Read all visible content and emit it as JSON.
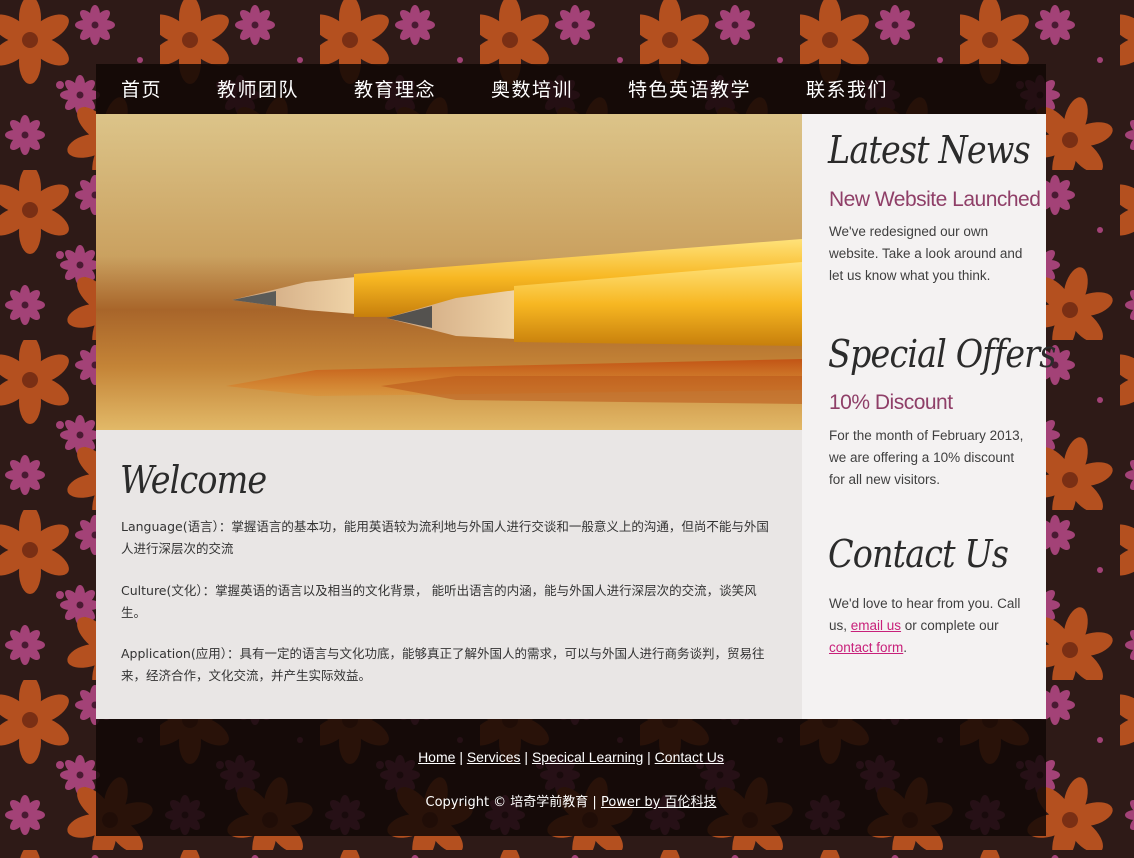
{
  "nav": {
    "items": [
      "首页",
      "教师团队",
      "教育理念",
      "奥数培训",
      "特色英语教学",
      "联系我们"
    ]
  },
  "main": {
    "welcome_title": "Welcome",
    "paragraphs": [
      "Language(语言）：掌握语言的基本功，能用英语较为流利地与外国人进行交谈和一般意义上的沟通，但尚不能与外国人进行深层次的交流",
      "Culture(文化）：掌握英语的语言以及相当的文化背景， 能听出语言的内涵，能与外国人进行深层次的交流，谈笑风生。",
      "Application(应用）：具有一定的语言与文化功底，能够真正了解外国人的需求，可以与外国人进行商务谈判，贸易往来，经济合作，文化交流，并产生实际效益。"
    ]
  },
  "sidebar": {
    "news": {
      "title": "Latest News",
      "subtitle": "New Website Launched",
      "text": "We've redesigned our own website. Take a look around and let us know what you think."
    },
    "offers": {
      "title": "Special Offers",
      "subtitle": "10% Discount",
      "text": "For the month of February 2013, we are offering a 10% discount for all new visitors."
    },
    "contact": {
      "title": "Contact Us",
      "text_before": "We'd love to hear from you. Call us, ",
      "email_link": "email us",
      "text_middle": " or complete our ",
      "form_link": "contact form",
      "text_after": "."
    }
  },
  "footer": {
    "links": [
      "Home",
      "Services",
      "Specical Learning",
      "Contact Us"
    ],
    "separator": "|",
    "copyright": "Copyright © 培奇学前教育 | ",
    "power_link": "Power by 百伦科技"
  },
  "colors": {
    "accent": "#8f3f68",
    "link": "#c8207a",
    "content_bg": "#e9e6e5",
    "sidebar_bg": "#f4f2f2",
    "page_bg": "#2e1a17"
  }
}
